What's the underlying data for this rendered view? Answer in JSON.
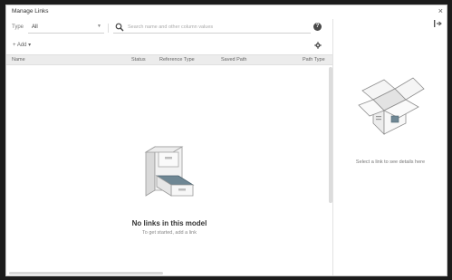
{
  "window": {
    "title": "Manage Links",
    "close_glyph": "×"
  },
  "filter": {
    "type_label": "Type",
    "type_value": "All",
    "search_placeholder": "Search name and other column values"
  },
  "toolbar": {
    "add_label": "+ Add ▾"
  },
  "columns": [
    "Name",
    "Status",
    "Reference Type",
    "Saved Path",
    "Path Type"
  ],
  "empty_state": {
    "title": "No links in this model",
    "subtitle": "To get started, add a link"
  },
  "details": {
    "placeholder": "Select a link to see details here"
  },
  "icons": {
    "search": "search-icon",
    "help": "help-icon",
    "settings": "gear-icon",
    "panel": "collapse-panel-icon",
    "close": "close-icon"
  }
}
